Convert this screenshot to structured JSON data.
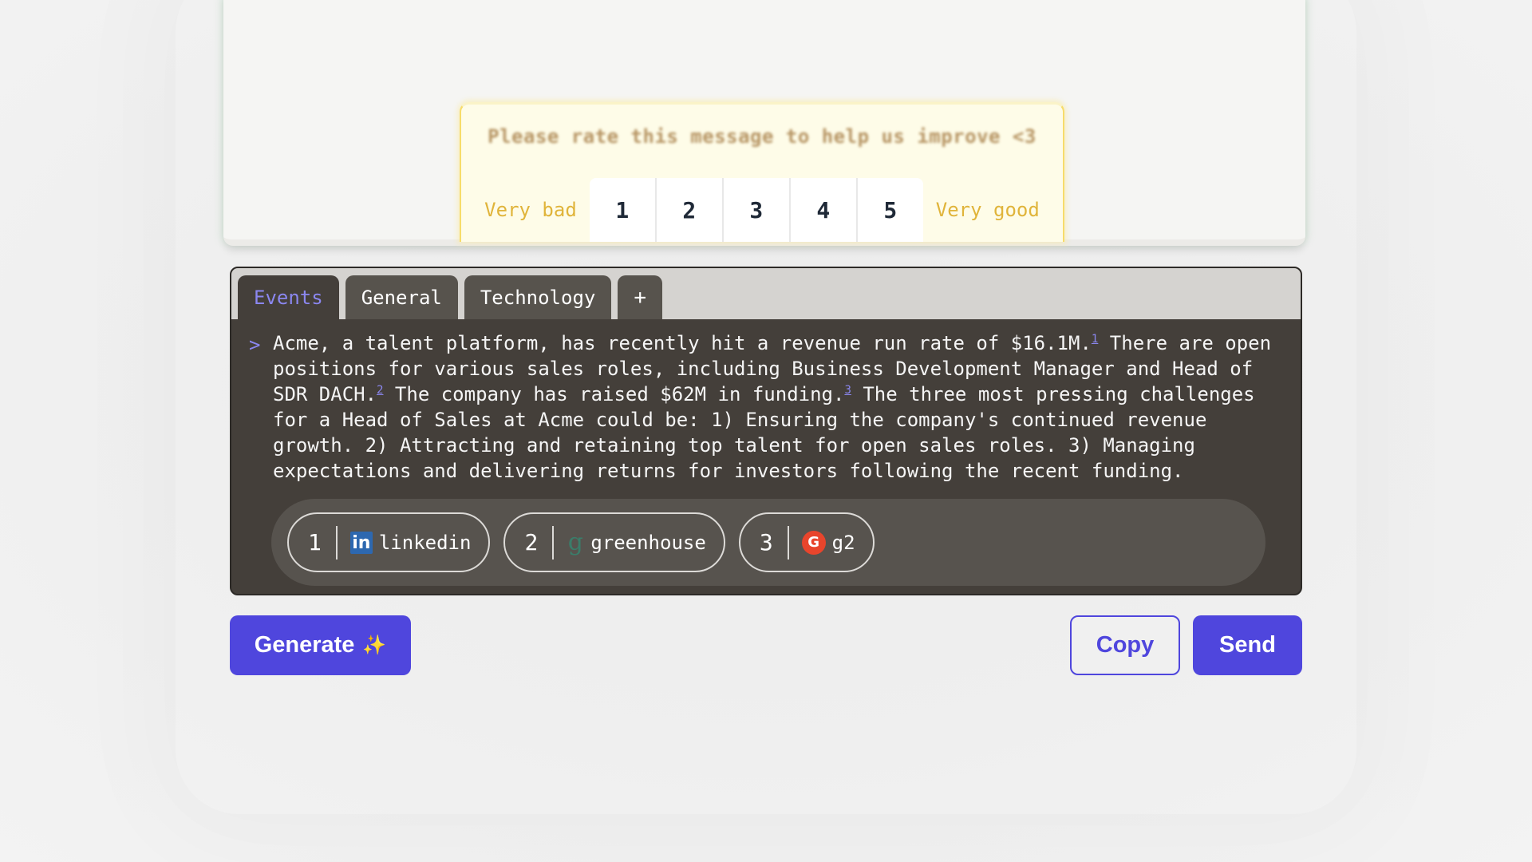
{
  "rating": {
    "prompt": "Please rate this message to help us improve <3",
    "low_label": "Very bad",
    "high_label": "Very good",
    "options": [
      "1",
      "2",
      "3",
      "4",
      "5"
    ]
  },
  "editor": {
    "tabs": [
      {
        "label": "Events",
        "active": true
      },
      {
        "label": "General",
        "active": false
      },
      {
        "label": "Technology",
        "active": false
      }
    ],
    "add_tab_label": "+",
    "caret": ">",
    "segments": [
      {
        "text": "Acme, a talent platform, has recently hit a revenue run rate of $16.1M.",
        "cite": "1"
      },
      {
        "text": " There are open positions for various sales roles, including Business Development Manager and Head of SDR DACH.",
        "cite": "2"
      },
      {
        "text": " The company has raised $62M in funding.",
        "cite": "3"
      },
      {
        "text": " The three most pressing challenges for a Head of Sales at Acme could be: 1) Ensuring the company's continued revenue growth. 2) Attracting and retaining top talent for open sales roles. 3) Managing expectations and delivering returns for investors following the recent funding.",
        "cite": null
      }
    ],
    "sources": [
      {
        "number": "1",
        "icon": "linkedin-icon",
        "label": "linkedin"
      },
      {
        "number": "2",
        "icon": "greenhouse-icon",
        "label": "greenhouse"
      },
      {
        "number": "3",
        "icon": "g2-icon",
        "label": "g2"
      }
    ]
  },
  "actions": {
    "generate_label": "Generate",
    "generate_emoji": "✨",
    "copy_label": "Copy",
    "send_label": "Send"
  },
  "colors": {
    "accent": "#4f46dd",
    "active_tab_text": "#8b87f0",
    "panel_bg": "#443f3a",
    "rating_label": "#e0b43a"
  }
}
